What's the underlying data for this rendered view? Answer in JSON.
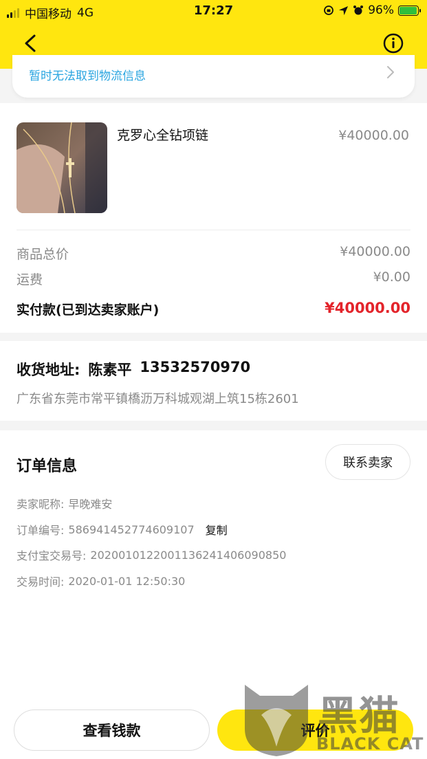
{
  "status_bar": {
    "carrier": "中国移动",
    "network": "4G",
    "time": "17:27",
    "battery": "96%",
    "battery_level": 0.96
  },
  "nav": {
    "back_icon": "chevron-left-icon",
    "info_icon": "info-circle-icon"
  },
  "logistics": {
    "text": "暂时无法取到物流信息"
  },
  "product": {
    "title": "克罗心全钻项链",
    "price": "¥40000.00"
  },
  "summary": {
    "items": [
      {
        "label": "商品总价",
        "value": "¥40000.00"
      },
      {
        "label": "运费",
        "value": "¥0.00"
      }
    ],
    "total_label": "实付款(已到达卖家账户)",
    "total_value": "¥40000.00"
  },
  "address": {
    "label": "收货地址:",
    "name": "陈素平",
    "phone": "13532570970",
    "detail": "广东省东莞市常平镇橋沥万科城观湖上筑15栋2601"
  },
  "order": {
    "title": "订单信息",
    "contact_seller": "联系卖家",
    "seller_label": "卖家昵称:",
    "seller_value": "早晚难安",
    "order_no_label": "订单编号:",
    "order_no_value": "586941452774609107",
    "copy_label": "复制",
    "alipay_label": "支付宝交易号:",
    "alipay_value": "2020010122001136241406090850",
    "time_label": "交易时间:",
    "time_value": "2020-01-01 12:50:30"
  },
  "actions": {
    "view_money": "查看钱款",
    "review": "评价"
  },
  "watermark": {
    "text_cn": "黑猫",
    "text_en": "BLACK CAT"
  },
  "colors": {
    "brand_yellow": "#ffe60f",
    "price_red": "#e3242b",
    "link_blue": "#2aa5e0"
  }
}
